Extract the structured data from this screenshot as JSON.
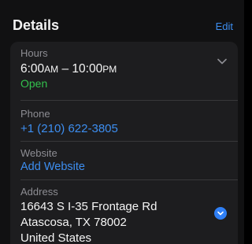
{
  "header": {
    "title": "Details",
    "edit_label": "Edit"
  },
  "hours": {
    "label": "Hours",
    "open_time": "6:00",
    "open_ampm": "AM",
    "separator": " – ",
    "close_time": "10:00",
    "close_ampm": "PM",
    "status": "Open",
    "expand_icon": "chevron-down-icon"
  },
  "phone": {
    "label": "Phone",
    "value": "+1 (210) 622-3805"
  },
  "website": {
    "label": "Website",
    "value": "Add Website"
  },
  "address": {
    "label": "Address",
    "line1": "16643 S I-35 Frontage Rd",
    "line2": "Atascosa, TX  78002",
    "line3": "United States",
    "action_icon": "directions-icon"
  },
  "colors": {
    "accent": "#3d8ef0",
    "open_status": "#33c24d",
    "background": "#111112",
    "card": "#1d1d1f"
  }
}
